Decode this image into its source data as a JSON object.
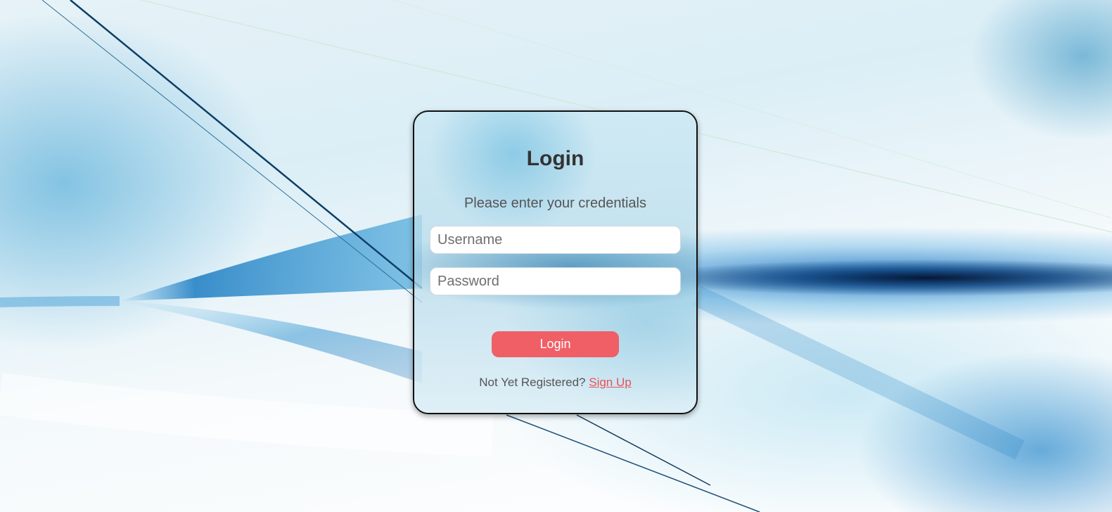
{
  "login": {
    "title": "Login",
    "subtitle": "Please enter your credentials",
    "username_placeholder": "Username",
    "password_placeholder": "Password",
    "submit_label": "Login",
    "register_prompt": "Not Yet Registered?",
    "signup_link": "Sign Up"
  },
  "colors": {
    "accent": "#f05f66",
    "link": "#e8525b",
    "title_text": "#333333",
    "card_border": "#111111"
  }
}
